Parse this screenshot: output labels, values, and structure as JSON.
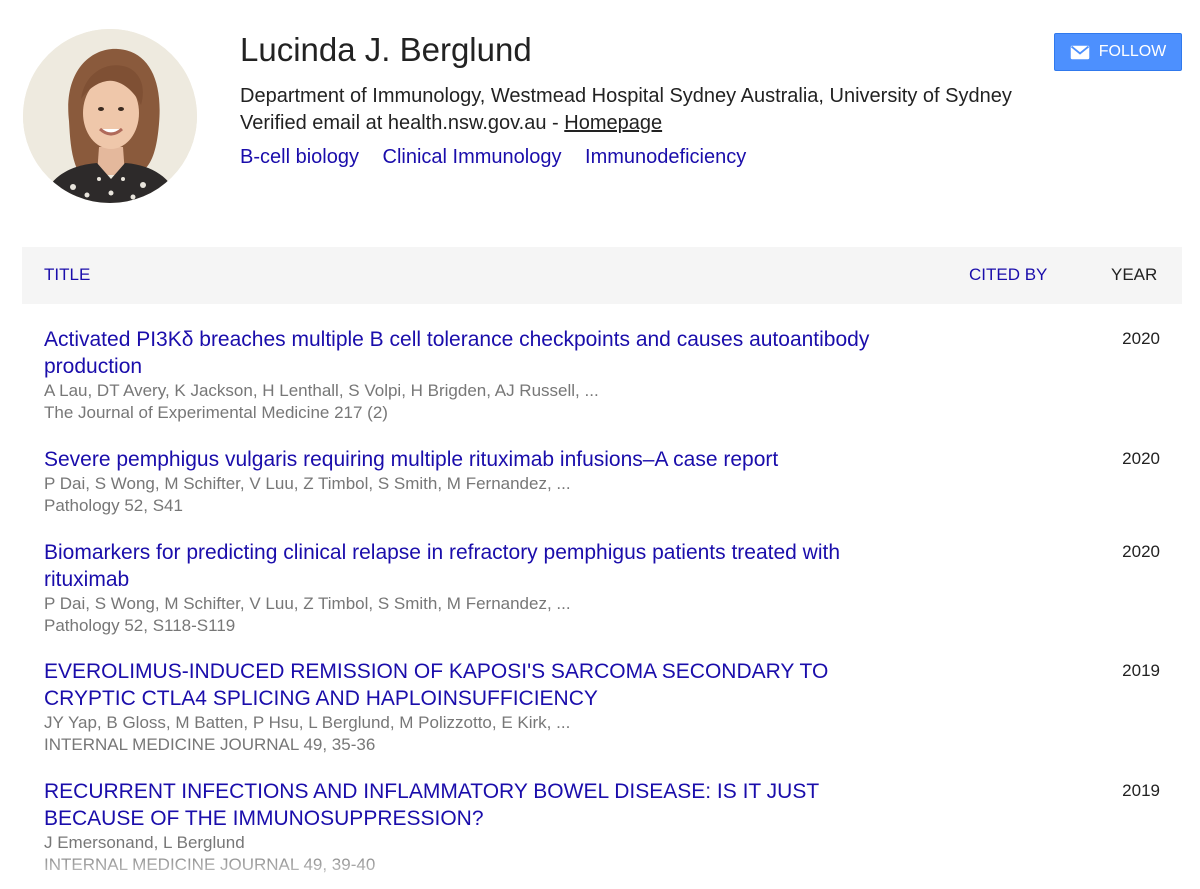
{
  "profile": {
    "name": "Lucinda J. Berglund",
    "affiliation": "Department of Immunology, Westmead Hospital Sydney Australia, University of Sydney",
    "email_text": "Verified email at health.nsw.gov.au - ",
    "homepage_label": "Homepage",
    "interests": [
      "B-cell biology",
      "Clinical Immunology",
      "Immunodeficiency"
    ]
  },
  "follow": {
    "label": "FOLLOW",
    "icon": "envelope-icon",
    "color": "#4d90fe"
  },
  "table": {
    "headers": {
      "title": "TITLE",
      "cited_by": "CITED BY",
      "year": "YEAR"
    },
    "rows": [
      {
        "title": "Activated PI3Kδ breaches multiple B cell tolerance checkpoints and causes autoantibody production",
        "authors": "A Lau, DT Avery, K Jackson, H Lenthall, S Volpi, H Brigden, AJ Russell, ...",
        "venue": "The Journal of Experimental Medicine 217 (2)",
        "year": "2020"
      },
      {
        "title": "Severe pemphigus vulgaris requiring multiple rituximab infusions–A case report",
        "authors": "P Dai, S Wong, M Schifter, V Luu, Z Timbol, S Smith, M Fernandez, ...",
        "venue": "Pathology 52, S41",
        "year": "2020"
      },
      {
        "title": "Biomarkers for predicting clinical relapse in refractory pemphigus patients treated with rituximab",
        "authors": "P Dai, S Wong, M Schifter, V Luu, Z Timbol, S Smith, M Fernandez, ...",
        "venue": "Pathology 52, S118-S119",
        "year": "2020"
      },
      {
        "title": "EVEROLIMUS-INDUCED REMISSION OF KAPOSI'S SARCOMA SECONDARY TO CRYPTIC CTLA4 SPLICING AND HAPLOINSUFFICIENCY",
        "authors": "JY Yap, B Gloss, M Batten, P Hsu, L Berglund, M Polizzotto, E Kirk, ...",
        "venue": "INTERNAL MEDICINE JOURNAL 49, 35-36",
        "year": "2019"
      },
      {
        "title": "RECURRENT INFECTIONS AND INFLAMMATORY BOWEL DISEASE: IS IT JUST BECAUSE OF THE IMMUNOSUPPRESSION?",
        "authors": "J Emersonand, L Berglund",
        "venue": "INTERNAL MEDICINE JOURNAL 49, 39-40",
        "year": "2019"
      }
    ]
  },
  "colors": {
    "link": "#1a0dab",
    "meta": "#777777",
    "header_bg": "#f5f5f5"
  }
}
